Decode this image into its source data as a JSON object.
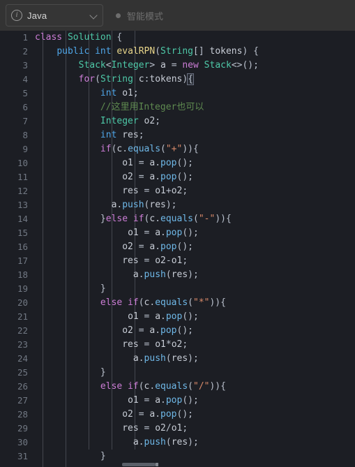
{
  "toolbar": {
    "language_selector": {
      "icon": "info-circle-icon",
      "label": "Java",
      "chevron": "chevron-down-icon"
    },
    "smart_mode": {
      "dot": "status-dot-icon",
      "label": "智能模式"
    }
  },
  "editor": {
    "language": "Java",
    "first_visible_line": 1,
    "last_visible_line": 31,
    "scrollbar": {
      "orientation": "horizontal"
    },
    "lines": [
      {
        "n": "1",
        "tokens": [
          {
            "t": "class",
            "c": "kw"
          },
          {
            "t": " ",
            "c": "pun"
          },
          {
            "t": "Solution",
            "c": "typ"
          },
          {
            "t": " {",
            "c": "pun"
          }
        ]
      },
      {
        "n": "2",
        "tokens": [
          {
            "t": "    ",
            "c": "pun"
          },
          {
            "t": "public",
            "c": "kw2"
          },
          {
            "t": " ",
            "c": "pun"
          },
          {
            "t": "int",
            "c": "kw2"
          },
          {
            "t": " ",
            "c": "pun"
          },
          {
            "t": "evalRPN",
            "c": "fn"
          },
          {
            "t": "(",
            "c": "pun"
          },
          {
            "t": "String",
            "c": "typ"
          },
          {
            "t": "[] ",
            "c": "pun"
          },
          {
            "t": "tokens",
            "c": "var"
          },
          {
            "t": ") {",
            "c": "pun"
          }
        ]
      },
      {
        "n": "3",
        "tokens": [
          {
            "t": "        ",
            "c": "pun"
          },
          {
            "t": "Stack",
            "c": "typ"
          },
          {
            "t": "<",
            "c": "pun"
          },
          {
            "t": "Integer",
            "c": "typ"
          },
          {
            "t": "> ",
            "c": "pun"
          },
          {
            "t": "a",
            "c": "var"
          },
          {
            "t": " = ",
            "c": "pun"
          },
          {
            "t": "new",
            "c": "kw"
          },
          {
            "t": " ",
            "c": "pun"
          },
          {
            "t": "Stack",
            "c": "typ"
          },
          {
            "t": "<>();",
            "c": "pun"
          }
        ]
      },
      {
        "n": "4",
        "tokens": [
          {
            "t": "        ",
            "c": "pun"
          },
          {
            "t": "for",
            "c": "kw"
          },
          {
            "t": "(",
            "c": "pun"
          },
          {
            "t": "String",
            "c": "typ"
          },
          {
            "t": " ",
            "c": "pun"
          },
          {
            "t": "c",
            "c": "var"
          },
          {
            "t": ":",
            "c": "pun"
          },
          {
            "t": "tokens",
            "c": "var"
          },
          {
            "t": ")",
            "c": "pun"
          },
          {
            "t": "{",
            "c": "brkhl pun"
          }
        ]
      },
      {
        "n": "5",
        "tokens": [
          {
            "t": "            ",
            "c": "pun"
          },
          {
            "t": "int",
            "c": "kw2"
          },
          {
            "t": " ",
            "c": "pun"
          },
          {
            "t": "o1",
            "c": "var"
          },
          {
            "t": ";",
            "c": "pun"
          }
        ]
      },
      {
        "n": "6",
        "tokens": [
          {
            "t": "            ",
            "c": "pun"
          },
          {
            "t": "//这里用Integer也可以",
            "c": "cmt"
          }
        ]
      },
      {
        "n": "7",
        "tokens": [
          {
            "t": "            ",
            "c": "pun"
          },
          {
            "t": "Integer",
            "c": "typ"
          },
          {
            "t": " ",
            "c": "pun"
          },
          {
            "t": "o2",
            "c": "var"
          },
          {
            "t": ";",
            "c": "pun"
          }
        ]
      },
      {
        "n": "8",
        "tokens": [
          {
            "t": "            ",
            "c": "pun"
          },
          {
            "t": "int",
            "c": "kw2"
          },
          {
            "t": " ",
            "c": "pun"
          },
          {
            "t": "res",
            "c": "var"
          },
          {
            "t": ";",
            "c": "pun"
          }
        ]
      },
      {
        "n": "9",
        "tokens": [
          {
            "t": "            ",
            "c": "pun"
          },
          {
            "t": "if",
            "c": "kw"
          },
          {
            "t": "(",
            "c": "pun"
          },
          {
            "t": "c",
            "c": "var"
          },
          {
            "t": ".",
            "c": "pun"
          },
          {
            "t": "equals",
            "c": "call"
          },
          {
            "t": "(",
            "c": "pun"
          },
          {
            "t": "\"+\"",
            "c": "str"
          },
          {
            "t": ")){",
            "c": "pun"
          }
        ]
      },
      {
        "n": "10",
        "tokens": [
          {
            "t": "                ",
            "c": "pun"
          },
          {
            "t": "o1",
            "c": "var"
          },
          {
            "t": " = ",
            "c": "pun"
          },
          {
            "t": "a",
            "c": "var"
          },
          {
            "t": ".",
            "c": "pun"
          },
          {
            "t": "pop",
            "c": "call"
          },
          {
            "t": "();",
            "c": "pun"
          }
        ]
      },
      {
        "n": "11",
        "tokens": [
          {
            "t": "                ",
            "c": "pun"
          },
          {
            "t": "o2",
            "c": "var"
          },
          {
            "t": " = ",
            "c": "pun"
          },
          {
            "t": "a",
            "c": "var"
          },
          {
            "t": ".",
            "c": "pun"
          },
          {
            "t": "pop",
            "c": "call"
          },
          {
            "t": "();",
            "c": "pun"
          }
        ]
      },
      {
        "n": "12",
        "tokens": [
          {
            "t": "                ",
            "c": "pun"
          },
          {
            "t": "res",
            "c": "var"
          },
          {
            "t": " = ",
            "c": "pun"
          },
          {
            "t": "o1",
            "c": "var"
          },
          {
            "t": "+",
            "c": "pun"
          },
          {
            "t": "o2",
            "c": "var"
          },
          {
            "t": ";",
            "c": "pun"
          }
        ]
      },
      {
        "n": "13",
        "tokens": [
          {
            "t": "              ",
            "c": "pun"
          },
          {
            "t": "a",
            "c": "var"
          },
          {
            "t": ".",
            "c": "pun"
          },
          {
            "t": "push",
            "c": "call"
          },
          {
            "t": "(",
            "c": "pun"
          },
          {
            "t": "res",
            "c": "var"
          },
          {
            "t": ");",
            "c": "pun"
          }
        ]
      },
      {
        "n": "14",
        "tokens": [
          {
            "t": "            ",
            "c": "pun"
          },
          {
            "t": "}",
            "c": "pun"
          },
          {
            "t": "else",
            "c": "kw"
          },
          {
            "t": " ",
            "c": "pun"
          },
          {
            "t": "if",
            "c": "kw"
          },
          {
            "t": "(",
            "c": "pun"
          },
          {
            "t": "c",
            "c": "var"
          },
          {
            "t": ".",
            "c": "pun"
          },
          {
            "t": "equals",
            "c": "call"
          },
          {
            "t": "(",
            "c": "pun"
          },
          {
            "t": "\"-\"",
            "c": "str"
          },
          {
            "t": ")){",
            "c": "pun"
          }
        ]
      },
      {
        "n": "15",
        "tokens": [
          {
            "t": "                 ",
            "c": "pun"
          },
          {
            "t": "o1",
            "c": "var"
          },
          {
            "t": " = ",
            "c": "pun"
          },
          {
            "t": "a",
            "c": "var"
          },
          {
            "t": ".",
            "c": "pun"
          },
          {
            "t": "pop",
            "c": "call"
          },
          {
            "t": "();",
            "c": "pun"
          }
        ]
      },
      {
        "n": "16",
        "tokens": [
          {
            "t": "                ",
            "c": "pun"
          },
          {
            "t": "o2",
            "c": "var"
          },
          {
            "t": " = ",
            "c": "pun"
          },
          {
            "t": "a",
            "c": "var"
          },
          {
            "t": ".",
            "c": "pun"
          },
          {
            "t": "pop",
            "c": "call"
          },
          {
            "t": "();",
            "c": "pun"
          }
        ]
      },
      {
        "n": "17",
        "tokens": [
          {
            "t": "                ",
            "c": "pun"
          },
          {
            "t": "res",
            "c": "var"
          },
          {
            "t": " = ",
            "c": "pun"
          },
          {
            "t": "o2",
            "c": "var"
          },
          {
            "t": "-",
            "c": "pun"
          },
          {
            "t": "o1",
            "c": "var"
          },
          {
            "t": ";",
            "c": "pun"
          }
        ]
      },
      {
        "n": "18",
        "tokens": [
          {
            "t": "                  ",
            "c": "pun"
          },
          {
            "t": "a",
            "c": "var"
          },
          {
            "t": ".",
            "c": "pun"
          },
          {
            "t": "push",
            "c": "call"
          },
          {
            "t": "(",
            "c": "pun"
          },
          {
            "t": "res",
            "c": "var"
          },
          {
            "t": ");",
            "c": "pun"
          }
        ]
      },
      {
        "n": "19",
        "tokens": [
          {
            "t": "            ",
            "c": "pun"
          },
          {
            "t": "}",
            "c": "pun"
          }
        ]
      },
      {
        "n": "20",
        "tokens": [
          {
            "t": "            ",
            "c": "pun"
          },
          {
            "t": "else",
            "c": "kw"
          },
          {
            "t": " ",
            "c": "pun"
          },
          {
            "t": "if",
            "c": "kw"
          },
          {
            "t": "(",
            "c": "pun"
          },
          {
            "t": "c",
            "c": "var"
          },
          {
            "t": ".",
            "c": "pun"
          },
          {
            "t": "equals",
            "c": "call"
          },
          {
            "t": "(",
            "c": "pun"
          },
          {
            "t": "\"*\"",
            "c": "str"
          },
          {
            "t": ")){",
            "c": "pun"
          }
        ]
      },
      {
        "n": "21",
        "tokens": [
          {
            "t": "                 ",
            "c": "pun"
          },
          {
            "t": "o1",
            "c": "var"
          },
          {
            "t": " = ",
            "c": "pun"
          },
          {
            "t": "a",
            "c": "var"
          },
          {
            "t": ".",
            "c": "pun"
          },
          {
            "t": "pop",
            "c": "call"
          },
          {
            "t": "();",
            "c": "pun"
          }
        ]
      },
      {
        "n": "22",
        "tokens": [
          {
            "t": "                ",
            "c": "pun"
          },
          {
            "t": "o2",
            "c": "var"
          },
          {
            "t": " = ",
            "c": "pun"
          },
          {
            "t": "a",
            "c": "var"
          },
          {
            "t": ".",
            "c": "pun"
          },
          {
            "t": "pop",
            "c": "call"
          },
          {
            "t": "();",
            "c": "pun"
          }
        ]
      },
      {
        "n": "23",
        "tokens": [
          {
            "t": "                ",
            "c": "pun"
          },
          {
            "t": "res",
            "c": "var"
          },
          {
            "t": " = ",
            "c": "pun"
          },
          {
            "t": "o1",
            "c": "var"
          },
          {
            "t": "*",
            "c": "pun"
          },
          {
            "t": "o2",
            "c": "var"
          },
          {
            "t": ";",
            "c": "pun"
          }
        ]
      },
      {
        "n": "24",
        "tokens": [
          {
            "t": "                  ",
            "c": "pun"
          },
          {
            "t": "a",
            "c": "var"
          },
          {
            "t": ".",
            "c": "pun"
          },
          {
            "t": "push",
            "c": "call"
          },
          {
            "t": "(",
            "c": "pun"
          },
          {
            "t": "res",
            "c": "var"
          },
          {
            "t": ");",
            "c": "pun"
          }
        ]
      },
      {
        "n": "25",
        "tokens": [
          {
            "t": "            ",
            "c": "pun"
          },
          {
            "t": "}",
            "c": "pun"
          }
        ]
      },
      {
        "n": "26",
        "tokens": [
          {
            "t": "            ",
            "c": "pun"
          },
          {
            "t": "else",
            "c": "kw"
          },
          {
            "t": " ",
            "c": "pun"
          },
          {
            "t": "if",
            "c": "kw"
          },
          {
            "t": "(",
            "c": "pun"
          },
          {
            "t": "c",
            "c": "var"
          },
          {
            "t": ".",
            "c": "pun"
          },
          {
            "t": "equals",
            "c": "call"
          },
          {
            "t": "(",
            "c": "pun"
          },
          {
            "t": "\"/\"",
            "c": "str"
          },
          {
            "t": ")){",
            "c": "pun"
          }
        ]
      },
      {
        "n": "27",
        "tokens": [
          {
            "t": "                 ",
            "c": "pun"
          },
          {
            "t": "o1",
            "c": "var"
          },
          {
            "t": " = ",
            "c": "pun"
          },
          {
            "t": "a",
            "c": "var"
          },
          {
            "t": ".",
            "c": "pun"
          },
          {
            "t": "pop",
            "c": "call"
          },
          {
            "t": "();",
            "c": "pun"
          }
        ]
      },
      {
        "n": "28",
        "tokens": [
          {
            "t": "                ",
            "c": "pun"
          },
          {
            "t": "o2",
            "c": "var"
          },
          {
            "t": " = ",
            "c": "pun"
          },
          {
            "t": "a",
            "c": "var"
          },
          {
            "t": ".",
            "c": "pun"
          },
          {
            "t": "pop",
            "c": "call"
          },
          {
            "t": "();",
            "c": "pun"
          }
        ]
      },
      {
        "n": "29",
        "tokens": [
          {
            "t": "                ",
            "c": "pun"
          },
          {
            "t": "res",
            "c": "var"
          },
          {
            "t": " = ",
            "c": "pun"
          },
          {
            "t": "o2",
            "c": "var"
          },
          {
            "t": "/",
            "c": "pun"
          },
          {
            "t": "o1",
            "c": "var"
          },
          {
            "t": ";",
            "c": "pun"
          }
        ]
      },
      {
        "n": "30",
        "tokens": [
          {
            "t": "                  ",
            "c": "pun"
          },
          {
            "t": "a",
            "c": "var"
          },
          {
            "t": ".",
            "c": "pun"
          },
          {
            "t": "push",
            "c": "call"
          },
          {
            "t": "(",
            "c": "pun"
          },
          {
            "t": "res",
            "c": "var"
          },
          {
            "t": ");",
            "c": "pun"
          }
        ]
      },
      {
        "n": "31",
        "tokens": [
          {
            "t": "            ",
            "c": "pun"
          },
          {
            "t": "}",
            "c": "pun"
          }
        ]
      }
    ],
    "indent_guides_x": [
      61,
      94,
      127,
      160,
      193
    ]
  },
  "colors": {
    "toolbar_bg": "#333333",
    "editor_bg": "#1c1e24",
    "line_number": "#717883",
    "keyword": "#cc7dd6",
    "modifier": "#4fa6e8",
    "type": "#4ec9a8",
    "method": "#e8d58a",
    "string": "#d98a6a",
    "comment": "#5f8b50",
    "text": "#bcc3cf",
    "indent_guide": "#44474f"
  }
}
